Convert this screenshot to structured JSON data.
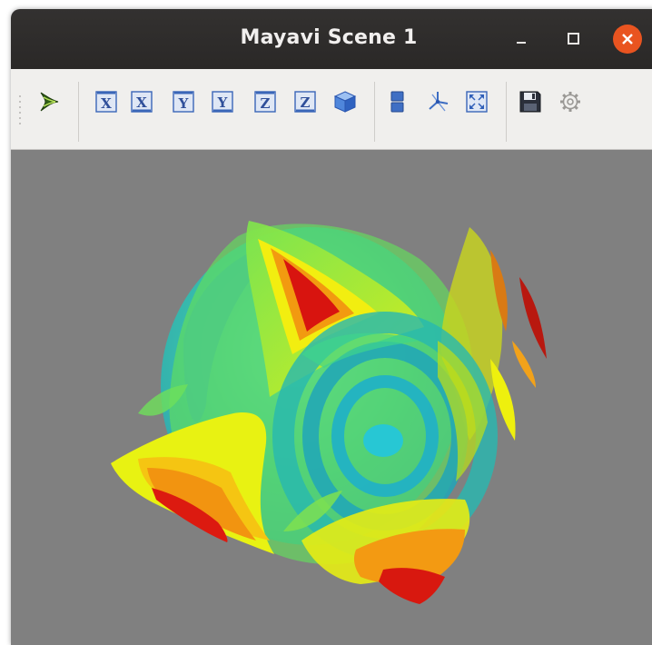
{
  "window": {
    "title": "Mayavi Scene 1"
  },
  "titlebar_buttons": [
    "minimize-button",
    "maximize-button",
    "close-button"
  ],
  "toolbar": {
    "axis_labels": [
      "X",
      "X",
      "Y",
      "Y",
      "Z",
      "Z"
    ],
    "icons": [
      "mayavi-pipeline-icon",
      "view-x-plus-icon",
      "view-x-minus-icon",
      "view-y-plus-icon",
      "view-y-minus-icon",
      "view-z-plus-icon",
      "view-z-minus-icon",
      "isometric-view-icon",
      "parallel-projection-icon",
      "axes-indicator-icon",
      "fullscreen-icon",
      "save-icon",
      "settings-gear-icon"
    ]
  },
  "scene": {
    "background_color": "#808080",
    "colormap": [
      "#1fb5c7",
      "#22cfa0",
      "#5fe05a",
      "#cfee1f",
      "#f6ef0c",
      "#f5a10b",
      "#e6420c",
      "#cc0e0e"
    ]
  },
  "colors": {
    "titlebar": "#2d2b2a",
    "close_button": "#e95420",
    "toolbar": "#f0efed",
    "axis_button_blue": "#3a66b8"
  }
}
